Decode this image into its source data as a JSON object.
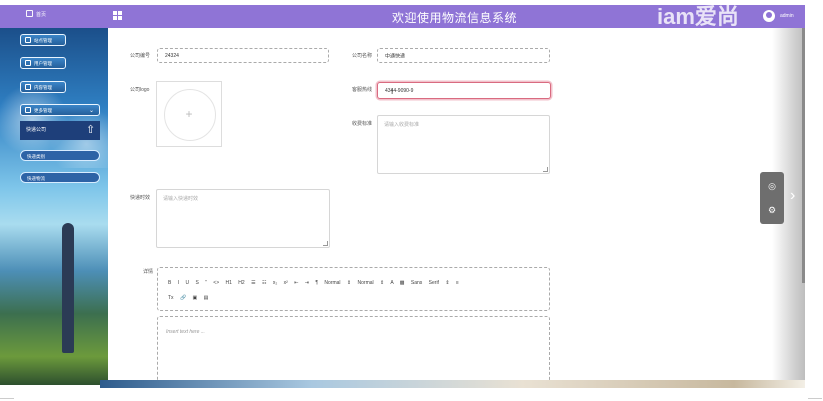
{
  "header": {
    "home_label": "首页",
    "title": "欢迎使用物流信息系统",
    "watermark": "iam爱尚",
    "username": "admin"
  },
  "sidebar": {
    "items": [
      {
        "label": "站点管理"
      },
      {
        "label": "用户管理"
      },
      {
        "label": "内容管理"
      }
    ],
    "expanded": {
      "label": "更多管理"
    },
    "sub_items": [
      {
        "label": "快递公司"
      },
      {
        "label": "快递类别"
      },
      {
        "label": "快递物流"
      }
    ]
  },
  "form": {
    "company_id": {
      "label": "公司编号",
      "value": "24324"
    },
    "company_name": {
      "label": "公司名称",
      "value": "中通快递"
    },
    "logo": {
      "label": "公司logo",
      "plus": "+"
    },
    "phone": {
      "label": "客服热线",
      "value": "4344-9090-9"
    },
    "fee": {
      "label": "收费标准",
      "placeholder": "请输入收费标准"
    },
    "timing": {
      "label": "快递时效",
      "placeholder": "请输入快递时效"
    },
    "details": {
      "label": "详情"
    }
  },
  "editor": {
    "toolbar_row1": "B I U S ” <> H1 H2 ☰ ☷ x₂ x² ⇤ ⇥ ¶ Normal ⇕ Normal ⇕ A ▩ Sans Serif ⇕ ≡",
    "toolbar_row2": "Tx 🔗 ▣ ▤",
    "placeholder": "Insert text here ..."
  },
  "side_tools": {
    "camera": "◎",
    "settings": "⚙",
    "arrow": "›"
  }
}
